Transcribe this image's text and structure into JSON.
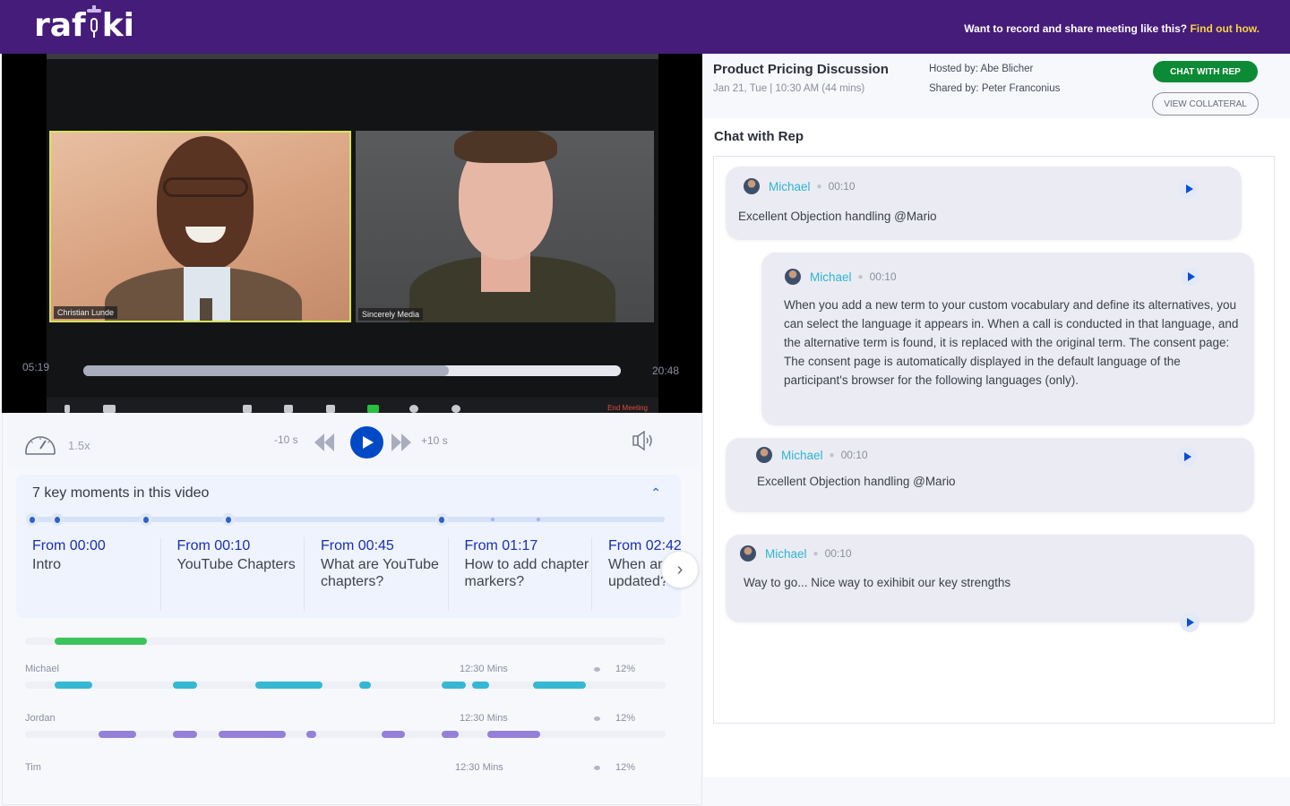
{
  "header": {
    "logo": {
      "pre": "raf",
      "post": "ki",
      "icon": "microphone-icon"
    },
    "promo_text": "Want to record and share meeting like this?",
    "promo_link": "Find out how."
  },
  "video": {
    "participants": [
      {
        "name": "Christian Lunde",
        "active_speaker": true
      },
      {
        "name": "Sincerely Media",
        "active_speaker": false
      }
    ],
    "current_time": "05:19",
    "total_time": "20:48",
    "progress_fraction": 0.68,
    "meeting_toolbar": {
      "icons": [
        "mute-icon",
        "video-camera-icon",
        "security-icon",
        "participants-icon",
        "chat-icon",
        "share-screen-icon",
        "record-icon",
        "reactions-icon"
      ],
      "end_label": "End Meeting"
    }
  },
  "controls": {
    "speed": "1.5x",
    "skip_back": "-10 s",
    "skip_forward": "+10 s",
    "icons": {
      "speed": "speedometer-icon",
      "rewind": "rewind-icon",
      "play": "play-icon",
      "forward": "fast-forward-icon",
      "volume": "volume-icon"
    }
  },
  "key_moments": {
    "title": "7 key moments in this video",
    "markers": [
      0.0,
      0.04,
      0.18,
      0.31,
      0.648,
      0.728,
      0.8
    ],
    "items": [
      {
        "from": "From 00:00",
        "desc": "Intro"
      },
      {
        "from": "From 00:10",
        "desc": "YouTube Chapters"
      },
      {
        "from": "From 00:45",
        "desc": "What are YouTube chapters?"
      },
      {
        "from": "From 01:17",
        "desc": "How to add chapter markers?"
      },
      {
        "from": "From 02:42",
        "desc": "When are changes updated?"
      }
    ]
  },
  "speakers": {
    "overall_segment": [
      0.046,
      0.19
    ],
    "overall_color": "#3cc45c",
    "rows": [
      {
        "name": "Michael",
        "duration": "12:30 Mins",
        "percent": "12%",
        "color": "#36b7d4",
        "segments": [
          [
            0.046,
            0.105
          ],
          [
            0.231,
            0.268
          ],
          [
            0.359,
            0.464
          ],
          [
            0.522,
            0.54
          ],
          [
            0.651,
            0.688
          ],
          [
            0.698,
            0.724
          ],
          [
            0.793,
            0.875
          ]
        ]
      },
      {
        "name": "Jordan",
        "duration": "12:30 Mins",
        "percent": "12%",
        "color": "#9580d9",
        "segments": [
          [
            0.114,
            0.173
          ],
          [
            0.231,
            0.268
          ],
          [
            0.302,
            0.407
          ],
          [
            0.439,
            0.455
          ],
          [
            0.556,
            0.593
          ],
          [
            0.65,
            0.677
          ],
          [
            0.722,
            0.804
          ]
        ]
      },
      {
        "name": "Tim",
        "duration": "12:30 Mins",
        "percent": "12%",
        "color": "#b4b7c3",
        "segments": []
      }
    ]
  },
  "meeting": {
    "title": "Product Pricing Discussion",
    "date": "Jan 21, Tue | 10:30 AM (44 mins)",
    "hosted_by": "Hosted by: Abe Blicher",
    "shared_by": "Shared by: Peter Franconius",
    "chat_button": "CHAT WITH REP",
    "collateral_button": "VIEW COLLATERAL"
  },
  "chat": {
    "heading": "Chat with Rep",
    "messages": [
      {
        "author": "Michael",
        "time": "00:10",
        "text": "Excellent Objection handling @Mario"
      },
      {
        "author": "Michael",
        "time": "00:10",
        "text": "When you add a new term to your custom vocabulary and define its alternatives, you can select the language it appears in. When a call is conducted in that language, and the alternative term is found, it is replaced with the original term. The consent page: The consent page is automatically displayed in the default language of the participant's browser for the following languages (only)."
      },
      {
        "author": "Michael",
        "time": "00:10",
        "text": "Excellent Objection handling @Mario"
      },
      {
        "author": "Michael",
        "time": "00:10",
        "text": "Way to go... Nice way to exihibit our key strengths"
      }
    ]
  }
}
